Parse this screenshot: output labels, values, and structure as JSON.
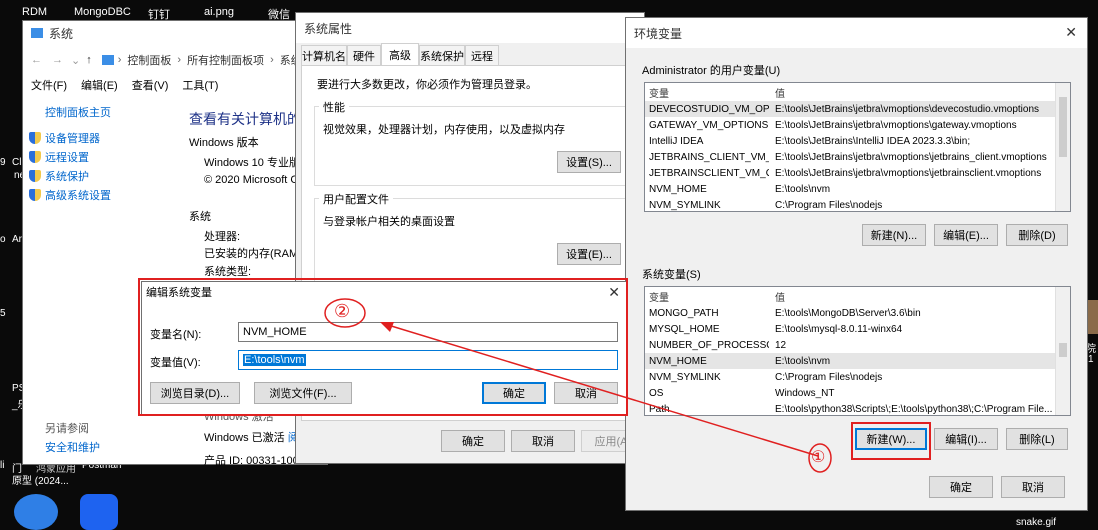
{
  "desktop": {
    "top_icons": [
      "RDM",
      "MongoDBC",
      "钉钉",
      "ai.png",
      "微信"
    ],
    "left_labels": [
      "9",
      "Cl",
      "ne",
      "o",
      "Ar",
      "5",
      "PS",
      "_乐",
      "li",
      "门"
    ],
    "bottom_labels": [
      "原型 (2024...",
      "Postman"
    ],
    "bottom_text_partial": "鸿蒙应用",
    "right_file": "snake.gif",
    "right_partial": [
      "院",
      "1"
    ]
  },
  "system_window": {
    "title": "系统",
    "address": [
      "控制面板",
      "所有控制面板项",
      "系统"
    ],
    "menu": [
      "文件(F)",
      "编辑(E)",
      "查看(V)",
      "工具(T)"
    ],
    "sidebar_home": "控制面板主页",
    "sidebar_links": [
      "设备管理器",
      "远程设置",
      "系统保护",
      "高级系统设置"
    ],
    "see_also_title": "另请参阅",
    "see_also_link": "安全和维护",
    "heading": "查看有关计算机的基",
    "windows_edition_label": "Windows 版本",
    "edition": "Windows 10 专业版",
    "copyright": "© 2020 Microsoft Co",
    "system_label": "系统",
    "processor": "处理器:",
    "ram": "已安装的内存(RAM):",
    "system_type": "系统类型:",
    "activation_label": "Windows 激活",
    "activation_text": "Windows 已激活",
    "activation_link": "阅",
    "product_id": "产品 ID: 00331-10000-00001-AA159"
  },
  "sysprops": {
    "title": "系统属性",
    "tabs": [
      "计算机名",
      "硬件",
      "高级",
      "系统保护",
      "远程"
    ],
    "active_tab": "高级",
    "admin_note": "要进行大多数更改，你必须作为管理员登录。",
    "perf_title": "性能",
    "perf_desc": "视觉效果，处理器计划，内存使用，以及虚拟内存",
    "perf_button": "设置(S)...",
    "profile_title": "用户配置文件",
    "profile_desc": "与登录帐户相关的桌面设置",
    "profile_button": "设置(E)...",
    "ok": "确定",
    "cancel": "取消",
    "apply": "应用(A"
  },
  "envvars": {
    "title": "环境变量",
    "user_group": "Administrator 的用户变量(U)",
    "col_var": "变量",
    "col_val": "值",
    "user_rows": [
      {
        "name": "DEVECOSTUDIO_VM_OPT...",
        "value": "E:\\tools\\JetBrains\\jetbra\\vmoptions\\devecostudio.vmoptions"
      },
      {
        "name": "GATEWAY_VM_OPTIONS",
        "value": "E:\\tools\\JetBrains\\jetbra\\vmoptions\\gateway.vmoptions"
      },
      {
        "name": "IntelliJ IDEA",
        "value": "E:\\tools\\JetBrains\\IntelliJ IDEA 2023.3.3\\bin;"
      },
      {
        "name": "JETBRAINS_CLIENT_VM_O...",
        "value": "E:\\tools\\JetBrains\\jetbra\\vmoptions\\jetbrains_client.vmoptions"
      },
      {
        "name": "JETBRAINSCLIENT_VM_O...",
        "value": "E:\\tools\\JetBrains\\jetbra\\vmoptions\\jetbrainsclient.vmoptions"
      },
      {
        "name": "NVM_HOME",
        "value": "E:\\tools\\nvm"
      },
      {
        "name": "NVM_SYMLINK",
        "value": "C:\\Program Files\\nodejs"
      }
    ],
    "user_new": "新建(N)...",
    "user_edit": "编辑(E)...",
    "user_delete": "删除(D)",
    "sys_group": "系统变量(S)",
    "sys_rows": [
      {
        "name": "MONGO_PATH",
        "value": "E:\\tools\\MongoDB\\Server\\3.6\\bin"
      },
      {
        "name": "MYSQL_HOME",
        "value": "E:\\tools\\mysql-8.0.11-winx64"
      },
      {
        "name": "NUMBER_OF_PROCESSORS",
        "value": "12"
      },
      {
        "name": "NVM_HOME",
        "value": "E:\\tools\\nvm"
      },
      {
        "name": "NVM_SYMLINK",
        "value": "C:\\Program Files\\nodejs"
      },
      {
        "name": "OS",
        "value": "Windows_NT"
      },
      {
        "name": "Path",
        "value": "E:\\tools\\python38\\Scripts\\;E:\\tools\\python38\\;C:\\Program File..."
      }
    ],
    "sys_new": "新建(W)...",
    "sys_edit": "编辑(I)...",
    "sys_delete": "删除(L)",
    "ok": "确定",
    "cancel": "取消"
  },
  "edit_dialog": {
    "title": "编辑系统变量",
    "name_label": "变量名(N):",
    "name_value": "NVM_HOME",
    "value_label": "变量值(V):",
    "value_value": "E:\\tools\\nvm",
    "browse_dir": "浏览目录(D)...",
    "browse_file": "浏览文件(F)...",
    "ok": "确定",
    "cancel": "取消"
  },
  "annotations": {
    "step1": "①",
    "step2": "②",
    "color": "#e02020"
  }
}
